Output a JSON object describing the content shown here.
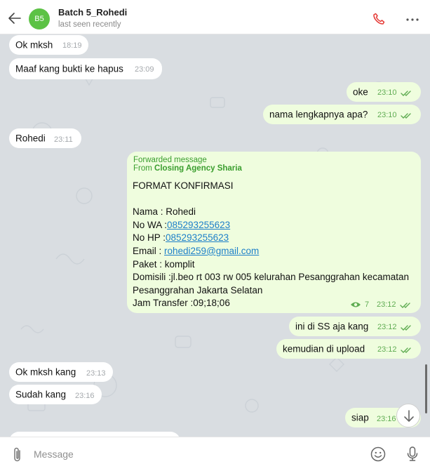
{
  "header": {
    "avatar_initials": "B5",
    "title": "Batch 5_Rohedi",
    "status": "last seen recently"
  },
  "colors": {
    "avatar": "#5cc245",
    "chat_background": "#d9dde1",
    "incoming_bubble": "#ffffff",
    "outgoing_bubble": "#effdde",
    "outgoing_time": "#5fac52",
    "link": "#1d7fc9",
    "call_icon": "#e53935"
  },
  "messages": [
    {
      "dir": "in",
      "text": "Ok mksh",
      "time": "18:19"
    },
    {
      "dir": "in",
      "text": "Maaf kang bukti ke hapus",
      "time": "23:09"
    },
    {
      "dir": "out",
      "text": "oke",
      "time": "23:10",
      "status": "read"
    },
    {
      "dir": "out",
      "text": "nama lengkapnya apa?",
      "time": "23:10",
      "status": "read"
    },
    {
      "dir": "in",
      "text": "Rohedi",
      "time": "23:11"
    },
    {
      "dir": "out",
      "text": "ini di SS aja kang",
      "time": "23:12",
      "status": "read"
    },
    {
      "dir": "out",
      "text": "kemudian di upload",
      "time": "23:12",
      "status": "read"
    },
    {
      "dir": "in",
      "text": "Ok mksh kang",
      "time": "23:13"
    },
    {
      "dir": "in",
      "text": "Sudah kang",
      "time": "23:16"
    },
    {
      "dir": "out",
      "text": "siap",
      "time": "23:16",
      "status": "read"
    }
  ],
  "forwarded": {
    "label": "Forwarded message",
    "from_prefix": "From",
    "from_name": "Closing Agency Sharia",
    "heading": "FORMAT KONFIRMASI",
    "nama": "Nama : Rohedi",
    "wa_label": "No WA :",
    "wa_number": "085293255623",
    "hp_label": "No HP :",
    "hp_number": "085293255623",
    "email_label": "Email : ",
    "email": "rohedi259@gmail.com",
    "paket": "Paket : komplit",
    "domisili_1": "Domisili :jl.beo rt 003 rw 005 kelurahan Pesanggrahan kecamatan",
    "domisili_2": "Pesanggrahan Jakarta Selatan",
    "jam": "Jam Transfer :09;18;06",
    "views": "7",
    "time": "23:12",
    "status": "read"
  },
  "composer": {
    "placeholder": "Message"
  },
  "icons": {
    "back": "arrow-left",
    "call": "phone",
    "more": "dots-horizontal",
    "attach": "paperclip",
    "emoji": "smiley",
    "mic": "microphone",
    "scroll_down": "arrow-down",
    "views": "eye",
    "read": "double-check"
  }
}
